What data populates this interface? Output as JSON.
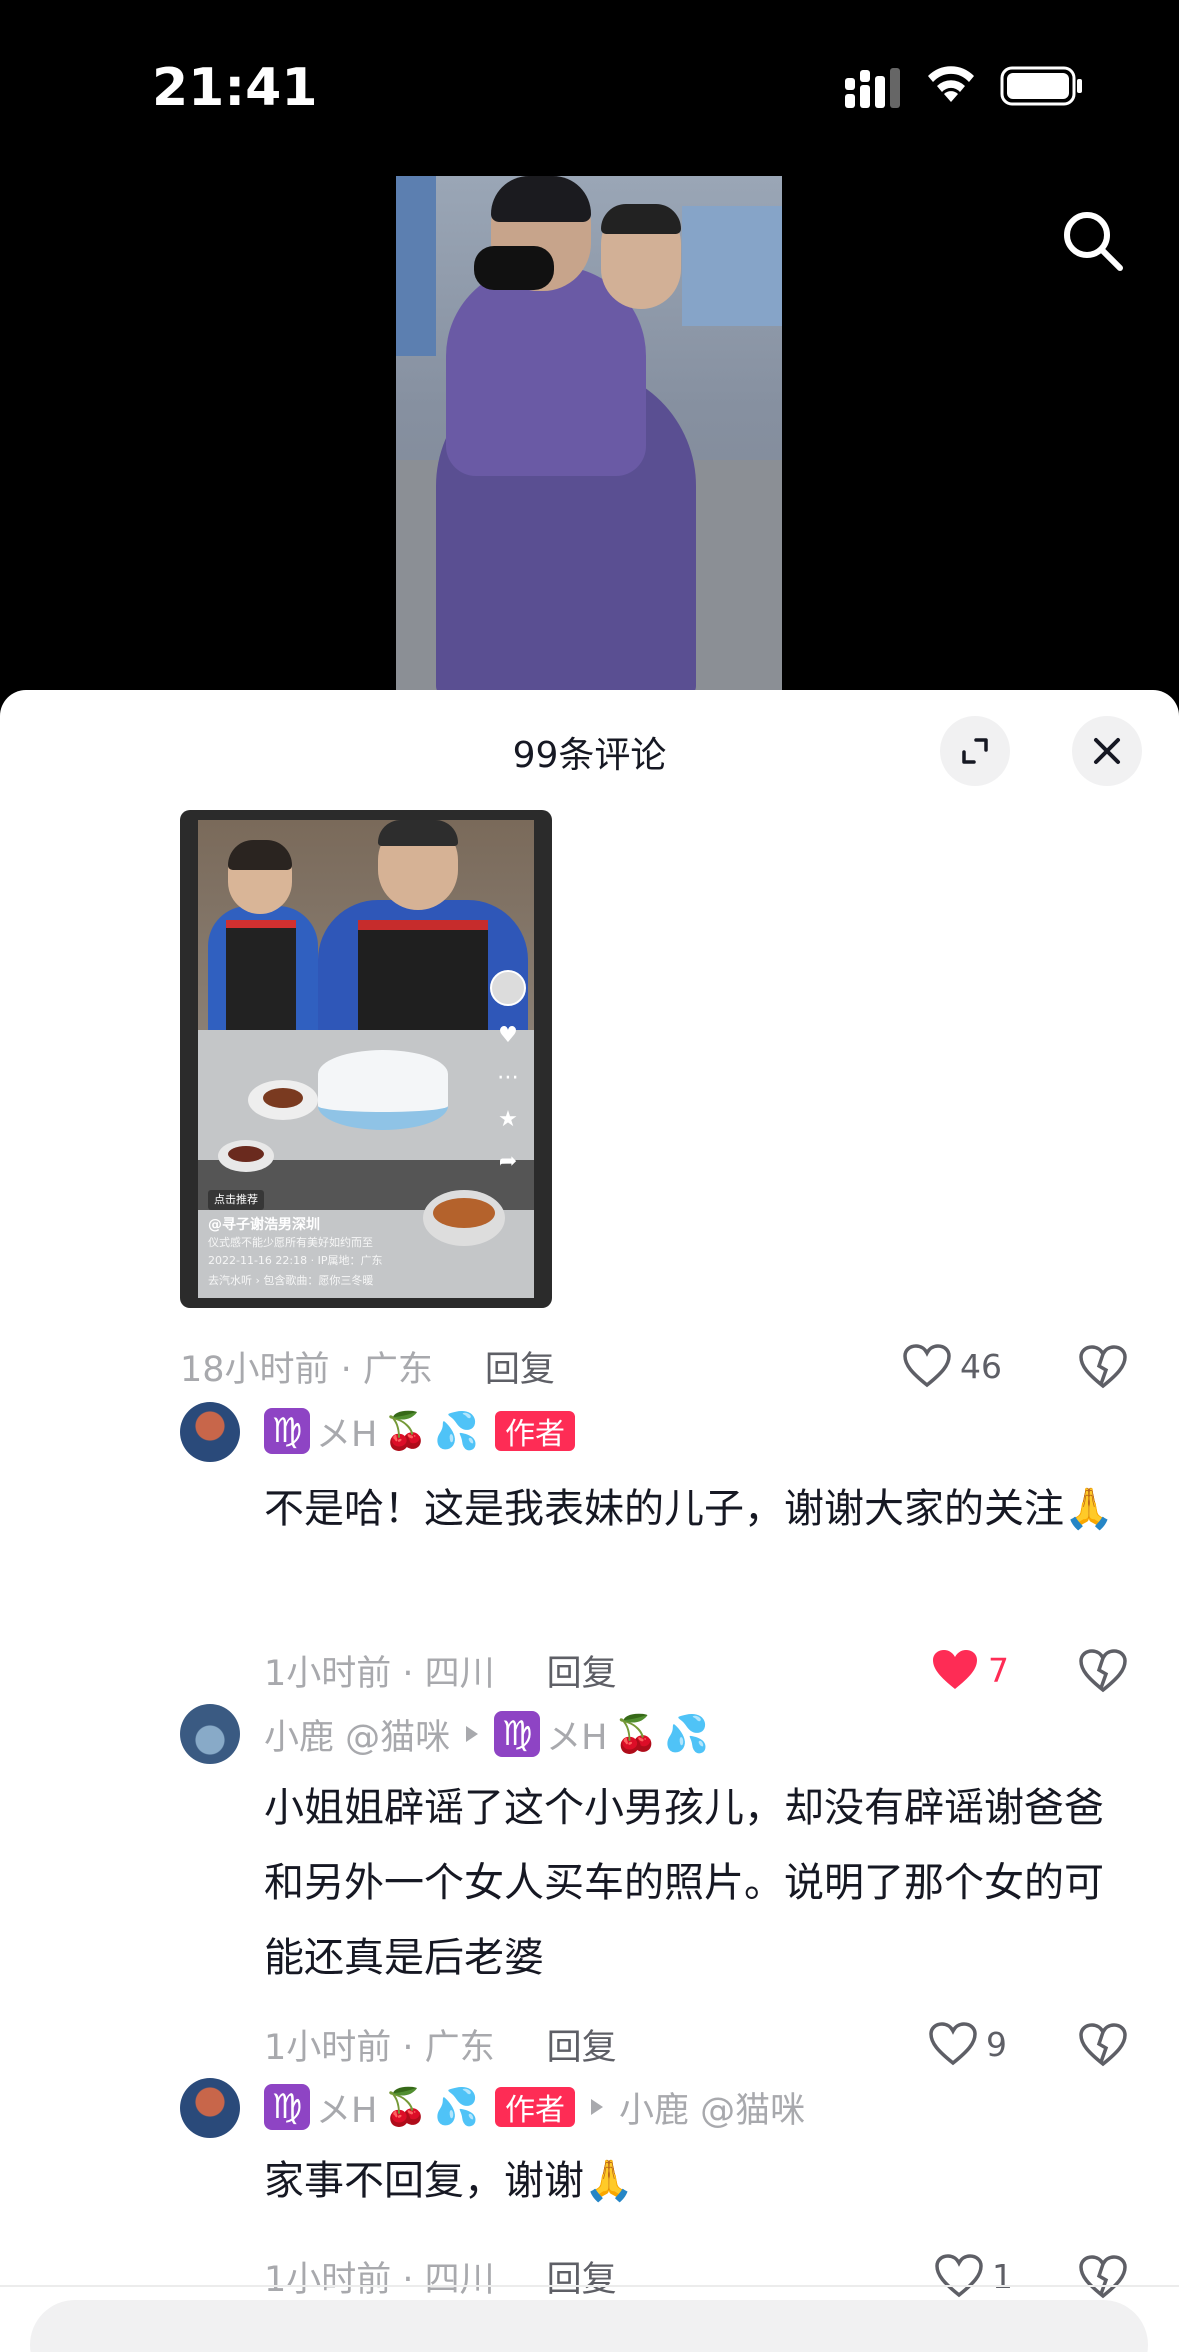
{
  "status_bar": {
    "time": "21:41"
  },
  "comments_panel": {
    "title": "99条评论"
  },
  "image_comment": {
    "embedded_video": {
      "recommend_tag": "点击推荐",
      "author": "@寻子谢浩男深圳",
      "caption": "仪式感不能少愿所有美好如约而至",
      "meta": "2022-11-16 22:18 · IP属地：广东",
      "music": "去汽水听 › 包含歌曲：愿你三冬暖"
    },
    "time_location": "18小时前 · 广东",
    "reply_label": "回复",
    "likes": "46",
    "liked": false
  },
  "comments": [
    {
      "name_prefix": "♍",
      "name": "メH",
      "name_emoji1": "🍒",
      "name_emoji2": "💦",
      "badge": "作者",
      "text": "不是哈！这是我表妹的儿子，谢谢大家的关注",
      "text_emoji": "🙏",
      "time_location": "1小时前 · 四川",
      "reply_label": "回复",
      "likes": "7",
      "liked": true
    },
    {
      "name": "小鹿 @猫咪",
      "reply_to_prefix": "♍",
      "reply_to": "メH",
      "reply_to_emoji1": "🍒",
      "reply_to_emoji2": "💦",
      "text": "小姐姐辟谣了这个小男孩儿，却没有辟谣谢爸爸和另外一个女人买车的照片。说明了那个女的可能还真是后老婆",
      "time_location": "1小时前 · 广东",
      "reply_label": "回复",
      "likes": "9",
      "liked": false
    },
    {
      "name_prefix": "♍",
      "name": "メH",
      "name_emoji1": "🍒",
      "name_emoji2": "💦",
      "badge": "作者",
      "reply_to": "小鹿 @猫咪",
      "text": "家事不回复，谢谢",
      "text_emoji": "🙏",
      "time_location": "1小时前 · 四川",
      "reply_label": "回复",
      "likes": "1",
      "liked": false
    }
  ],
  "colors": {
    "accent": "#fe2c55",
    "secondary_text": "#a8a9ad",
    "primary_text": "#161823"
  }
}
